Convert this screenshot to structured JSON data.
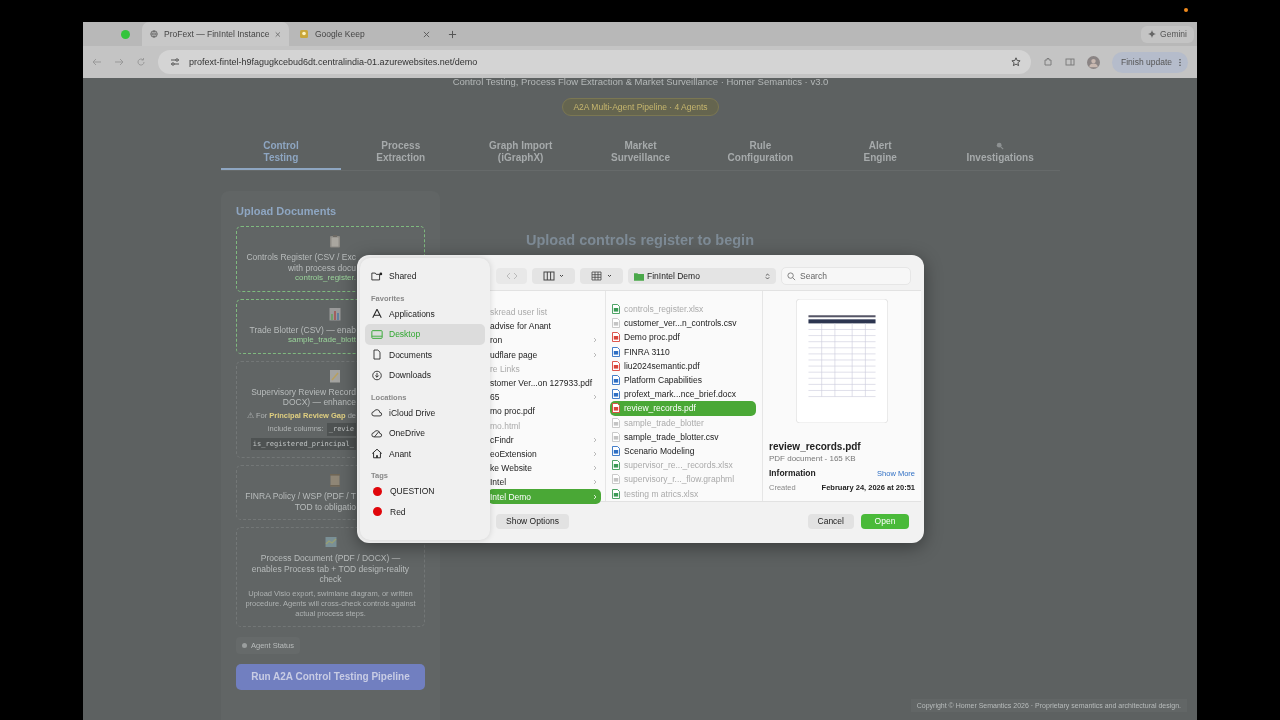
{
  "browser": {
    "tabs": [
      {
        "title": "ProFext — FinIntel Instance",
        "kind": "globe",
        "selected": true
      },
      {
        "title": "Google Keep",
        "kind": "keep",
        "selected": false
      }
    ],
    "gemini": "Gemini",
    "url": "profext-fintel-h9fagugkcebud6dt.centralindia-01.azurewebsites.net/demo",
    "update_button": "Finish update"
  },
  "page": {
    "subtitle": "Control Testing, Process Flow Extraction & Market Surveillance · Homer Semantics · v3.0",
    "badge": "A2A Multi-Agent Pipeline · 4 Agents",
    "tabs": [
      {
        "label": "Control\nTesting",
        "selected": true,
        "kind": "text"
      },
      {
        "label": "Process\nExtraction",
        "selected": false,
        "kind": "text"
      },
      {
        "label": "Graph Import\n(iGraphX)",
        "selected": false,
        "kind": "text"
      },
      {
        "label": "Market\nSurveillance",
        "selected": false,
        "kind": "text"
      },
      {
        "label": "Rule\nConfiguration",
        "selected": false,
        "kind": "text"
      },
      {
        "label": "Alert\nEngine",
        "selected": false,
        "kind": "text"
      },
      {
        "label": "Investigations",
        "selected": false,
        "kind": "search"
      }
    ],
    "upload_panel": {
      "title": "Upload Documents",
      "cards": [
        {
          "kind": "clipboard",
          "uploaded": true,
          "title_lines": [
            "Controls Register (CSV / Exc",
            "with process docu"
          ],
          "filename": "controls_register."
        },
        {
          "kind": "chart",
          "uploaded": true,
          "title_lines": [
            "Trade Blotter (CSV) — enab"
          ],
          "filename": "sample_trade_blott"
        },
        {
          "kind": "memo",
          "uploaded": false,
          "title_lines": [
            "Supervisory Review Record",
            "DOCX) — enhance"
          ],
          "note_lines": [
            {
              "text": "⚠ For **Principal Review Gap** de"
            },
            {
              "text": "include columns:",
              "code": "_revie"
            },
            {
              "code": "is_registered_principal_"
            }
          ]
        },
        {
          "kind": "scroll",
          "uploaded": false,
          "title_lines": [
            "FINRA Policy / WSP (PDF / T",
            "TOD to obligatio"
          ]
        },
        {
          "kind": "map",
          "uploaded": false,
          "title_lines": [
            "Process Document (PDF / DOCX) —",
            "enables Process tab + TOD design-reality",
            "check"
          ],
          "description": "Upload Visio export, swimlane diagram, or written procedure. Agents will cross-check controls against actual process steps."
        }
      ],
      "agent_status": "Agent Status",
      "run_button": "Run A2A Control Testing Pipeline"
    },
    "main_heading": "Upload controls register to begin",
    "copyright": "Copyright © Homer Semantics 2026 · Proprietary semantics and architectural design."
  },
  "dialog": {
    "sidebar": [
      {
        "items": [
          {
            "label": "Shared",
            "kind": "shared",
            "selected": false
          }
        ]
      },
      {
        "heading": "Favorites",
        "items": [
          {
            "label": "Applications",
            "kind": "applications",
            "selected": false
          },
          {
            "label": "Desktop",
            "kind": "desktop",
            "selected": true
          },
          {
            "label": "Documents",
            "kind": "document",
            "selected": false
          },
          {
            "label": "Downloads",
            "kind": "download",
            "selected": false
          }
        ]
      },
      {
        "heading": "Locations",
        "items": [
          {
            "label": "iCloud Drive",
            "kind": "cloud",
            "selected": false
          },
          {
            "label": "OneDrive",
            "kind": "onedrive",
            "selected": false
          },
          {
            "label": "Anant",
            "kind": "home",
            "selected": false
          }
        ]
      },
      {
        "heading": "Tags",
        "items": [
          {
            "label": "QUESTION",
            "kind": "tag",
            "color": "#e0060b",
            "selected": false
          },
          {
            "label": "Red",
            "kind": "tag",
            "color": "#e0060b",
            "selected": false
          }
        ]
      }
    ],
    "location": "FinIntel Demo",
    "search": {
      "placeholder": "Search"
    },
    "column_1": [
      {
        "name": "skread user list",
        "kind": "file",
        "dimmed": true,
        "selected": false
      },
      {
        "name": "advise for Anant",
        "kind": "file",
        "dimmed": false,
        "selected": false
      },
      {
        "name": "ron",
        "kind": "folder",
        "dimmed": false,
        "selected": false
      },
      {
        "name": "udflare page",
        "kind": "folder",
        "dimmed": false,
        "selected": false
      },
      {
        "name": "re Links",
        "kind": "file",
        "dimmed": true,
        "selected": false
      },
      {
        "name": "stomer Ver...on 127933.pdf",
        "kind": "file",
        "dimmed": false,
        "selected": false
      },
      {
        "name": "65",
        "kind": "folder",
        "dimmed": false,
        "selected": false
      },
      {
        "name": "mo proc.pdf",
        "kind": "file",
        "dimmed": false,
        "selected": false
      },
      {
        "name": "mo.html",
        "kind": "file",
        "dimmed": true,
        "selected": false
      },
      {
        "name": "cFindr",
        "kind": "folder",
        "dimmed": false,
        "selected": false
      },
      {
        "name": "eoExtension",
        "kind": "folder",
        "dimmed": false,
        "selected": false
      },
      {
        "name": "ke Website",
        "kind": "folder",
        "dimmed": false,
        "selected": false
      },
      {
        "name": "Intel",
        "kind": "folder",
        "dimmed": false,
        "selected": false
      },
      {
        "name": "Intel Demo",
        "kind": "folder",
        "dimmed": false,
        "selected": true
      }
    ],
    "column_2": [
      {
        "name": "controls_register.xlsx",
        "kind": "sheet",
        "dimmed": true,
        "selected": false
      },
      {
        "name": "customer_ver...n_controls.csv",
        "kind": "file",
        "dimmed": false,
        "selected": false
      },
      {
        "name": "Demo proc.pdf",
        "kind": "pdf",
        "dimmed": false,
        "selected": false
      },
      {
        "name": "FINRA 3110",
        "kind": "doc",
        "dimmed": false,
        "selected": false
      },
      {
        "name": "liu2024semantic.pdf",
        "kind": "pdf",
        "dimmed": false,
        "selected": false
      },
      {
        "name": "Platform Capabilities",
        "kind": "doc",
        "dimmed": false,
        "selected": false
      },
      {
        "name": "profext_mark...nce_brief.docx",
        "kind": "doc",
        "dimmed": false,
        "selected": false
      },
      {
        "name": "review_records.pdf",
        "kind": "pdf",
        "dimmed": false,
        "selected": true
      },
      {
        "name": "sample_trade_blotter",
        "kind": "file",
        "dimmed": true,
        "selected": false
      },
      {
        "name": "sample_trade_blotter.csv",
        "kind": "file",
        "dimmed": false,
        "selected": false
      },
      {
        "name": "Scenario Modeling",
        "kind": "doc",
        "dimmed": false,
        "selected": false
      },
      {
        "name": "supervisor_re..._records.xlsx",
        "kind": "sheet",
        "dimmed": true,
        "selected": false
      },
      {
        "name": "supervisory_r..._flow.graphml",
        "kind": "file",
        "dimmed": true,
        "selected": false
      },
      {
        "name": "testing m atrics.xlsx",
        "kind": "sheet",
        "dimmed": true,
        "selected": false
      }
    ],
    "preview": {
      "filename": "review_records.pdf",
      "meta": "PDF document - 165 KB",
      "info_heading": "Information",
      "show_more": "Show More",
      "created_label": "Created",
      "created": "February 24, 2026 at 20:51"
    },
    "buttons": {
      "options": "Show Options",
      "cancel": "Cancel",
      "open": "Open"
    }
  }
}
